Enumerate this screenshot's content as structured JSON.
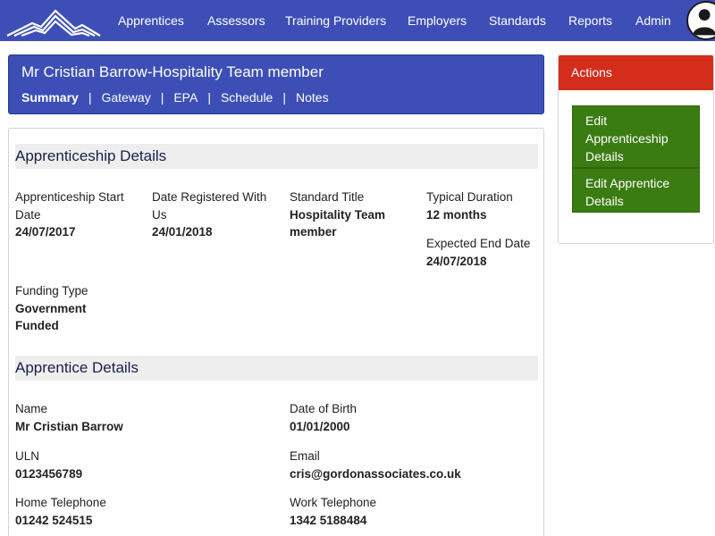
{
  "nav": {
    "items": [
      "Apprentices",
      "Assessors",
      "Training Providers",
      "Employers",
      "Standards",
      "Reports",
      "Admin"
    ]
  },
  "header": {
    "title": "Mr Cristian Barrow-Hospitality Team member",
    "tabs": [
      "Summary",
      "Gateway",
      "EPA",
      "Schedule",
      "Notes"
    ],
    "active_tab": "Summary"
  },
  "apprenticeship": {
    "heading": "Apprenticeship Details",
    "start_date_label": "Apprenticeship Start Date",
    "start_date": "24/07/2017",
    "registered_label": "Date Registered With Us",
    "registered": "24/01/2018",
    "standard_label": "Standard Title",
    "standard": "Hospitality Team member",
    "duration_label": "Typical Duration",
    "duration": "12 months",
    "end_date_label": "Expected End Date",
    "end_date": "24/07/2018",
    "funding_label": "Funding Type",
    "funding": "Government Funded"
  },
  "apprentice": {
    "heading": "Apprentice Details",
    "name_label": "Name",
    "name": "Mr Cristian Barrow",
    "dob_label": "Date of Birth",
    "dob": "01/01/2000",
    "uln_label": "ULN",
    "uln": "0123456789",
    "email_label": "Email",
    "email": "cris@gordonassociates.co.uk",
    "home_tel_label": "Home Telephone",
    "home_tel": "01242 524515",
    "work_tel_label": "Work Telephone",
    "work_tel": "1342 5188484"
  },
  "actions": {
    "heading": "Actions",
    "buttons": [
      "Edit Apprenticeship Details",
      "Edit Apprentice Details"
    ]
  },
  "colors": {
    "nav_blue": "#3d4fb6",
    "actions_red": "#d42d1c",
    "button_green": "#3b7c12"
  },
  "icons": {
    "logo": "mountain-logo-icon",
    "user": "user-avatar-icon"
  }
}
